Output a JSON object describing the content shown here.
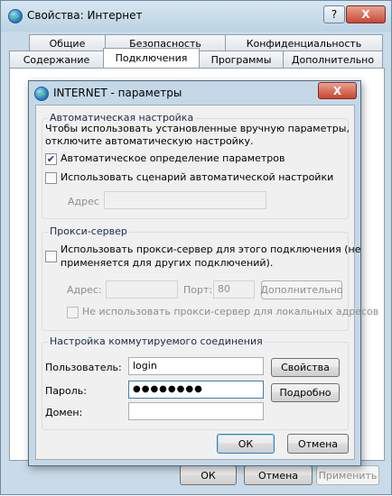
{
  "outer_window": {
    "title": "Свойства: Интернет",
    "help_label": "?",
    "close_label": "X",
    "tabs_row1": [
      "Общие",
      "Безопасность",
      "Конфиденциальность"
    ],
    "tabs_row2": [
      "Содержание",
      "Подключения",
      "Программы",
      "Дополнительно"
    ],
    "active_tab": "Подключения",
    "buttons": {
      "ok": "ОК",
      "cancel": "Отмена",
      "apply": "Применить"
    }
  },
  "dialog": {
    "title": "INTERNET - параметры",
    "close_label": "X",
    "auto_config": {
      "legend": "Автоматическая настройка",
      "description_line1": "Чтобы использовать установленные вручную параметры,",
      "description_line2": "отключите автоматическую настройку.",
      "auto_detect_label": "Автоматическое определение параметров",
      "auto_detect_checked": true,
      "use_script_label": "Использовать сценарий автоматической настройки",
      "use_script_checked": false,
      "address_label": "Адрес",
      "address_value": ""
    },
    "proxy": {
      "legend": "Прокси-сервер",
      "use_proxy_label_line1": "Использовать прокси-сервер для этого подключения (не",
      "use_proxy_label_line2": "применяется для других подключений).",
      "use_proxy_checked": false,
      "address_label": "Адрес:",
      "address_value": "",
      "port_label": "Порт:",
      "port_value": "80",
      "advanced_button": "Дополнительно",
      "bypass_local_label": "Не использовать прокси-сервер для локальных адресов",
      "bypass_local_checked": false
    },
    "dialup": {
      "legend": "Настройка коммутируемого соединения",
      "user_label": "Пользователь:",
      "user_value": "login",
      "password_label": "Пароль:",
      "password_value": "●●●●●●●●",
      "domain_label": "Домен:",
      "domain_value": "",
      "properties_button": "Свойства",
      "details_button": "Подробно"
    },
    "buttons": {
      "ok": "ОК",
      "cancel": "Отмена"
    }
  }
}
